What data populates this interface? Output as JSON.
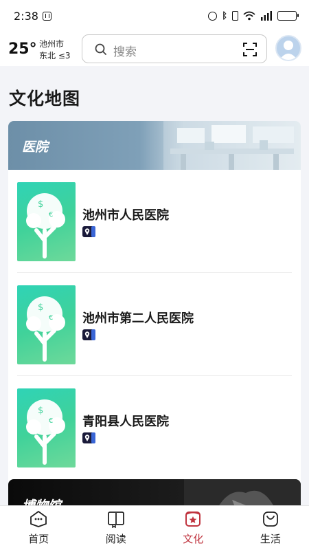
{
  "status_bar": {
    "time": "2:38"
  },
  "header": {
    "weather": {
      "temperature": "25°",
      "city": "池州市",
      "wind": "东北 ≤3"
    },
    "search": {
      "placeholder": "搜索"
    }
  },
  "page": {
    "title": "文化地图"
  },
  "categories": [
    {
      "label": "医院",
      "places": [
        {
          "name": "池州市人民医院"
        },
        {
          "name": "池州市第二人民医院"
        },
        {
          "name": "青阳县人民医院"
        }
      ]
    },
    {
      "label": "博物馆"
    }
  ],
  "bottom_nav": {
    "items": [
      {
        "label": "首页",
        "icon": "home-icon"
      },
      {
        "label": "阅读",
        "icon": "book-icon"
      },
      {
        "label": "文化",
        "icon": "culture-icon",
        "active": true
      },
      {
        "label": "生活",
        "icon": "bag-icon"
      }
    ]
  },
  "colors": {
    "accent": "#c0343f",
    "thumb_green": "#40d29a",
    "banner_blue": "#6d8fa8"
  }
}
